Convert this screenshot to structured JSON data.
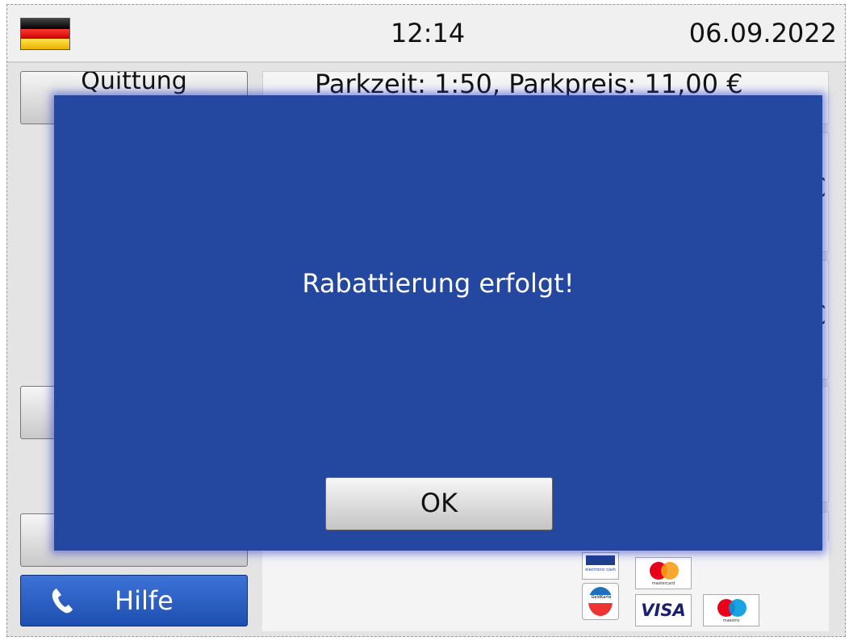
{
  "header": {
    "language_flag": "flag-de-icon",
    "time": "12:14",
    "date": "06.09.2022"
  },
  "sidebar": {
    "receipt_label": "Quittung",
    "help_label": "Hilfe",
    "help_icon": "phone-icon"
  },
  "main": {
    "info_text": "Parkzeit: 1:50, Parkpreis: 11,00 €",
    "currency_symbol": "€"
  },
  "payment_logos": [
    "electronic-cash",
    "mastercard",
    "girocard",
    "visa",
    "maestro"
  ],
  "payment_text": {
    "ec": "electronic cash",
    "mastercard": "mastercard",
    "geldkarte": "GeldKarte",
    "visa": "VISA",
    "maestro": "maestro"
  },
  "dialog": {
    "message": "Rabattierung erfolgt!",
    "ok_label": "OK"
  },
  "colors": {
    "dialog_bg": "#24479f",
    "help_button": "#2d5fc4"
  }
}
